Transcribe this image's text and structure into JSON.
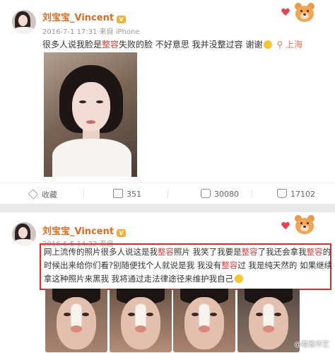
{
  "post1": {
    "username": "刘宝宝_Vincent",
    "verified_badge": "V",
    "meta": "2016-7-1 17:31 来自 iPhone",
    "text_before": "很多人说我脸是",
    "text_highlight": "整容",
    "text_after": "失败的脸 不好意思 我并没整过容 谢谢",
    "location_icon": "location-pin-icon",
    "location": "上海",
    "actions": {
      "favorite_label": "收藏",
      "repost_count": "351",
      "comment_count": "30080",
      "like_count": "17102"
    }
  },
  "post2": {
    "username": "刘宝宝_Vincent",
    "verified_badge": "V",
    "meta": "2016-6-5 14:32 来自",
    "quote": {
      "line1": [
        "网上流传的照片很多人说这是我",
        "整容",
        "照片 我笑了我要是",
        "整容",
        "了我还会拿我",
        "整容",
        "的"
      ],
      "line2": [
        "时候出来给你们看?别随便找个人就说是我 我没有",
        "整容",
        "过 我是纯天然的 如果继续"
      ],
      "line3": "拿这种照片来黑我 我将通过走法律途径来维护我自己"
    }
  },
  "watermark": "@看雅华艺",
  "colors": {
    "username": "#e06a1e",
    "highlight": "#e0403c",
    "quote_border": "#d52f2f",
    "location": "#eb7350"
  }
}
